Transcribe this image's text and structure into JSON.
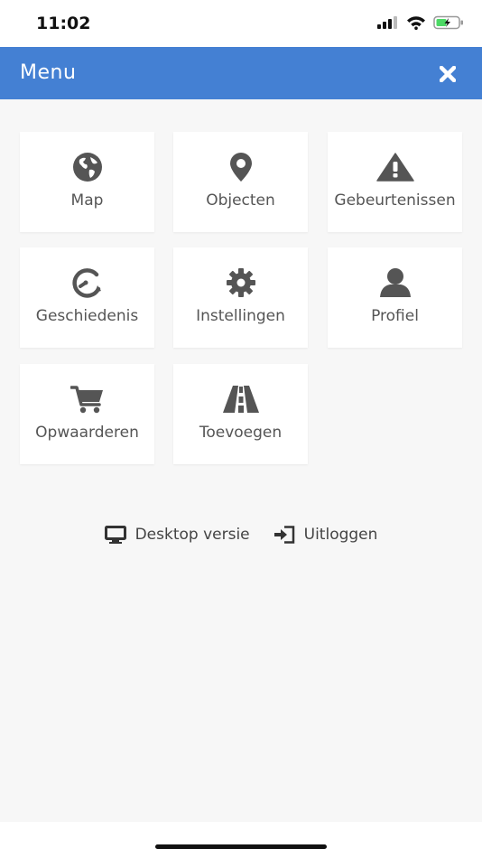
{
  "status_bar": {
    "time": "11:02"
  },
  "header": {
    "title": "Menu",
    "close_icon": "close-icon",
    "color": "#4480d3"
  },
  "tiles": [
    {
      "label": "Map",
      "icon": "globe-icon"
    },
    {
      "label": "Objecten",
      "icon": "map-pin-icon"
    },
    {
      "label": "Gebeurtenissen",
      "icon": "warning-icon"
    },
    {
      "label": "Geschiedenis",
      "icon": "history-icon"
    },
    {
      "label": "Instellingen",
      "icon": "gear-icon"
    },
    {
      "label": "Profiel",
      "icon": "user-icon"
    },
    {
      "label": "Opwaarderen",
      "icon": "cart-icon"
    },
    {
      "label": "Toevoegen",
      "icon": "road-icon"
    }
  ],
  "links": {
    "desktop": {
      "label": "Desktop versie",
      "icon": "monitor-icon"
    },
    "logout": {
      "label": "Uitloggen",
      "icon": "sign-out-icon"
    }
  }
}
